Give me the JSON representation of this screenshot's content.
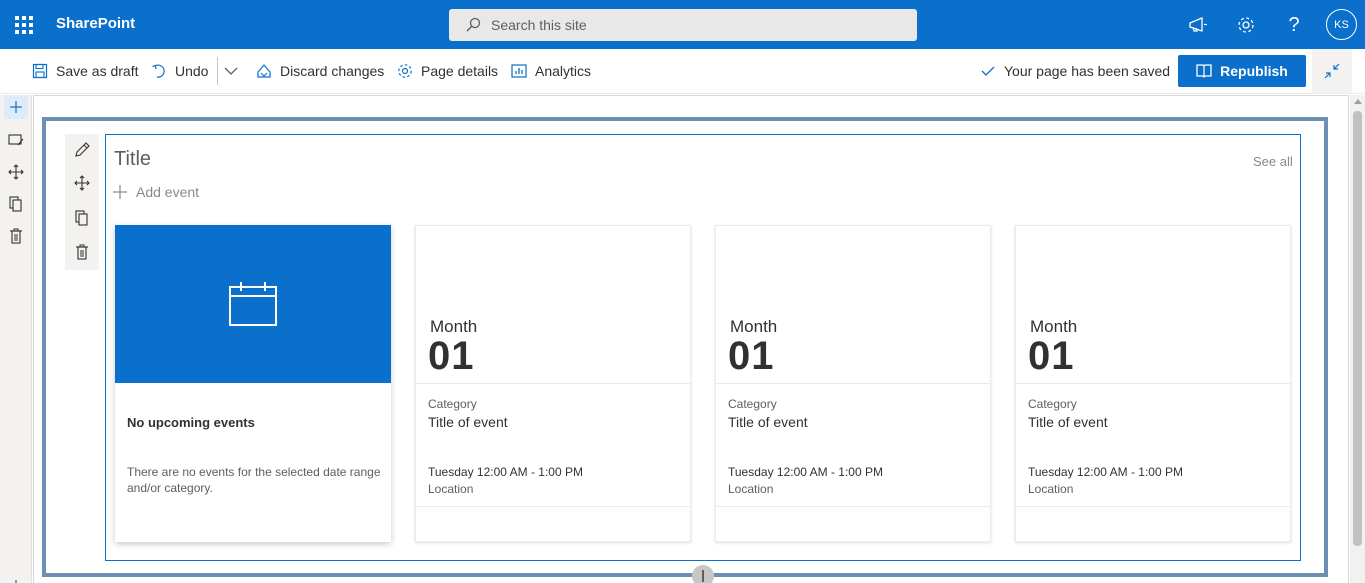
{
  "suite_bar": {
    "brand": "SharePoint",
    "search_placeholder": "Search this site",
    "user_initials": "KS"
  },
  "command_bar": {
    "save_as_draft": "Save as draft",
    "undo": "Undo",
    "discard_changes": "Discard changes",
    "page_details": "Page details",
    "analytics": "Analytics",
    "status": "Your page has been saved",
    "republish": "Republish"
  },
  "events_webpart": {
    "title": "Title",
    "see_all": "See all",
    "add_event": "Add event",
    "empty_card": {
      "heading": "No upcoming events",
      "description": "There are no events for the selected date range and/or category."
    },
    "events": [
      {
        "month": "Month",
        "day": "01",
        "category": "Category",
        "title": "Title of event",
        "time": "Tuesday 12:00 AM - 1:00 PM",
        "location": "Location"
      },
      {
        "month": "Month",
        "day": "01",
        "category": "Category",
        "title": "Title of event",
        "time": "Tuesday 12:00 AM - 1:00 PM",
        "location": "Location"
      },
      {
        "month": "Month",
        "day": "01",
        "category": "Category",
        "title": "Title of event",
        "time": "Tuesday 12:00 AM - 1:00 PM",
        "location": "Location"
      }
    ]
  },
  "colors": {
    "brand_blue": "#0b6fcc",
    "section_border": "#6e8fb4"
  }
}
